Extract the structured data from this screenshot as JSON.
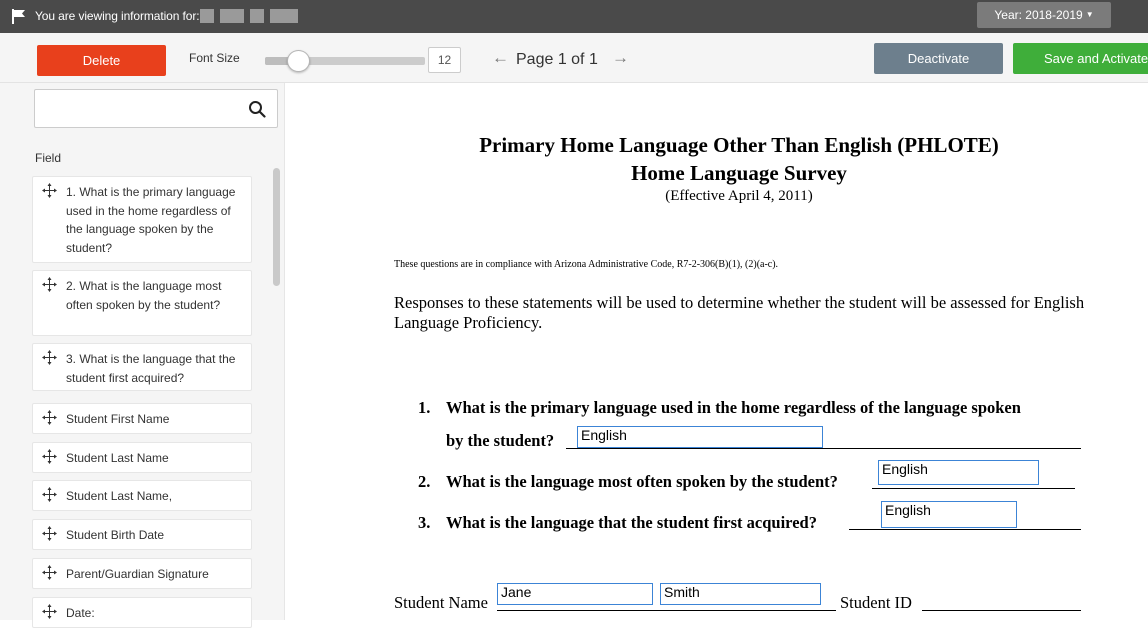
{
  "topbar": {
    "viewing_label": "You are viewing information for:",
    "year_label": "Year: 2018-2019"
  },
  "toolbar": {
    "delete_label": "Delete",
    "font_size_label": "Font Size",
    "font_size_value": "12",
    "font_size_slider_level": 0.16,
    "page_label": "Page 1 of 1",
    "deactivate_label": "Deactivate",
    "save_activate_label": "Save and Activate"
  },
  "colors": {
    "topbar": "#4a4a4a",
    "delete": "#e8401c",
    "deactivate": "#6d7f8d",
    "save": "#3fae3a",
    "field_border": "#3c84d6"
  },
  "sidebar": {
    "search_placeholder": "",
    "field_header": "Field",
    "fields": [
      "1. What is the primary language used in the home regardless of the language spoken by the student?",
      "2. What is the language most often spoken by the student?",
      "3. What is the language that the student first acquired?",
      "Student First Name",
      "Student Last Name",
      "Student Last Name,",
      "Student Birth Date",
      "Parent/Guardian Signature",
      "Date:"
    ]
  },
  "document": {
    "title_line1": "Primary Home Language Other Than English (PHLOTE)",
    "title_line2": "Home Language Survey",
    "effective": "(Effective April 4, 2011)",
    "compliance": "These questions are in compliance with Arizona Administrative Code, R7-2-306(B)(1), (2)(a-c).",
    "responses": "Responses to these statements will be used to determine whether the student will be assessed for English Language Proficiency.",
    "q1_num": "1.",
    "q1_text": "What is the primary language used in the home regardless of the language spoken",
    "q1_text_cont": "by the student?",
    "q1_answer": "English",
    "q2_num": "2.",
    "q2_text": "What is the language most often spoken by the student?",
    "q2_answer": "English",
    "q3_num": "3.",
    "q3_text": "What is the language that the student first acquired?",
    "q3_answer": "English",
    "student_name_label": "Student Name",
    "first_name_value": "Jane",
    "last_name_value": "Smith",
    "student_id_label": "Student ID"
  }
}
